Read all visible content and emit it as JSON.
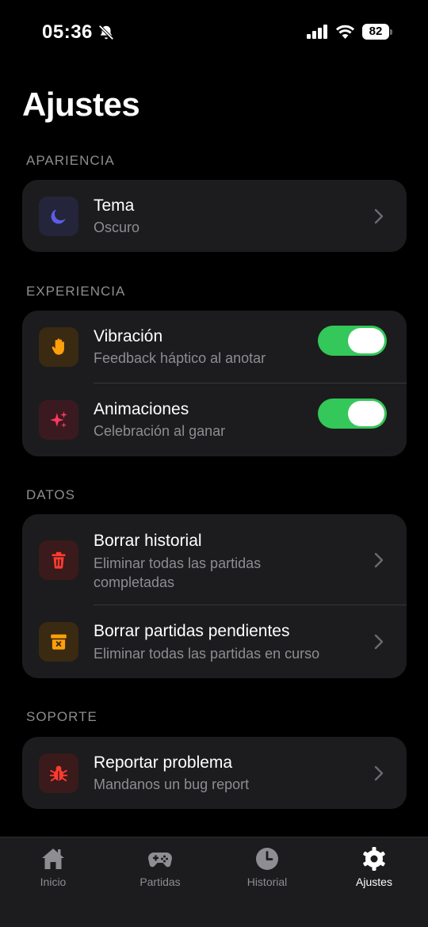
{
  "status": {
    "time": "05:36",
    "battery": "82"
  },
  "page": {
    "title": "Ajustes"
  },
  "sections": {
    "appearance": {
      "header": "APARIENCIA",
      "theme": {
        "title": "Tema",
        "subtitle": "Oscuro"
      }
    },
    "experience": {
      "header": "EXPERIENCIA",
      "vibration": {
        "title": "Vibración",
        "subtitle": "Feedback háptico al anotar",
        "enabled": true
      },
      "animations": {
        "title": "Animaciones",
        "subtitle": "Celebración al ganar",
        "enabled": true
      }
    },
    "data": {
      "header": "DATOS",
      "clear_history": {
        "title": "Borrar historial",
        "subtitle": "Eliminar todas las partidas completadas"
      },
      "clear_pending": {
        "title": "Borrar partidas pendientes",
        "subtitle": "Eliminar todas las partidas en curso"
      }
    },
    "support": {
      "header": "SOPORTE",
      "report": {
        "title": "Reportar problema",
        "subtitle": "Mandanos un bug report"
      }
    }
  },
  "tabs": [
    {
      "label": "Inicio",
      "icon": "home-icon"
    },
    {
      "label": "Partidas",
      "icon": "gamepad-icon"
    },
    {
      "label": "Historial",
      "icon": "clock-icon"
    },
    {
      "label": "Ajustes",
      "icon": "gear-icon",
      "active": true
    }
  ],
  "colors": {
    "accent_green": "#34c759",
    "card_bg": "#1c1c1e",
    "moon_purple": "#5e5ce6",
    "hand_orange": "#ff9f0a",
    "sparkle_red": "#ff375f",
    "trash_red": "#ff3b30"
  }
}
